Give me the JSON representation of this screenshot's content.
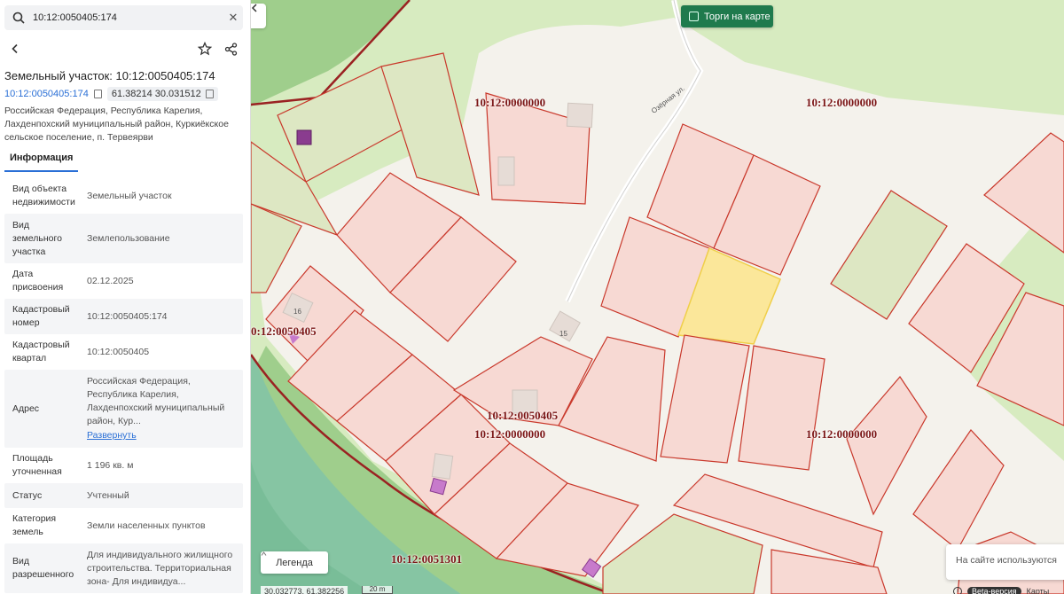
{
  "search": {
    "value": "10:12:0050405:174"
  },
  "parcel": {
    "title": "Земельный участок: 10:12:0050405:174",
    "cadastral_number": "10:12:0050405:174",
    "coordinates": "61.38214 30.031512",
    "address_line": "Российская Федерация, Республика Карелия, Лахденпохский муниципальный район, Куркиёкское сельское поселение, п. Тервеярви"
  },
  "tabs": {
    "info": "Информация"
  },
  "info_rows": [
    {
      "key": "Вид объекта недвижимости",
      "value": "Земельный участок"
    },
    {
      "key": "Вид земельного участка",
      "value": "Землепользование"
    },
    {
      "key": "Дата присвоения",
      "value": "02.12.2025"
    },
    {
      "key": "Кадастровый номер",
      "value": "10:12:0050405:174"
    },
    {
      "key": "Кадастровый квартал",
      "value": "10:12:0050405"
    },
    {
      "key": "Адрес",
      "value": "Российская Федерация, Республика Карелия, Лахденпохский муниципальный район, Кур...",
      "link": "Развернуть"
    },
    {
      "key": "Площадь уточненная",
      "value": "1 196 кв. м"
    },
    {
      "key": "Статус",
      "value": "Учтенный"
    },
    {
      "key": "Категория земель",
      "value": "Земли населенных пунктов"
    },
    {
      "key": "Вид разрешенного",
      "value": "Для индивидуального жилищного строительства. Территориальная зона- Для индивидуа..."
    }
  ],
  "map": {
    "torgi_label": "Торги на карте",
    "legend_label": "Легенда",
    "coords": "30.032773, 61.382256",
    "scale": "20 m",
    "cookie_text": "На сайте используются",
    "beta": "Beta-версия",
    "maps_link": "Карты",
    "street": "Озёрная ул.",
    "labels": {
      "l1": "10:12:0000000",
      "l2": "10:12:0000000",
      "l3": "0:12:0050405",
      "l4": "10:12:0050405",
      "l5": "10:12:0000000",
      "l6": "10:12:0000000",
      "l7": "10:12:0051301"
    },
    "building_numbers": {
      "b16": "16",
      "b15": "15"
    }
  },
  "colors": {
    "accent": "#2a6fd6",
    "parcel_border": "#c9382b",
    "selected_parcel": "#fbe79a",
    "torgi_bg": "#1f7a4d"
  }
}
